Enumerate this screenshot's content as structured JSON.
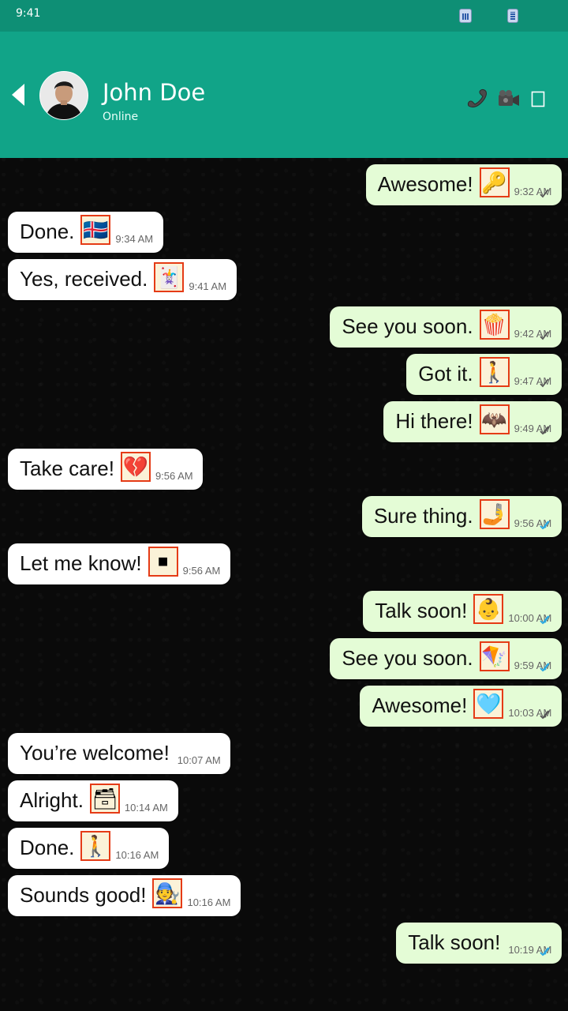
{
  "status_bar": {
    "time": "9:41"
  },
  "header": {
    "name": "John Doe",
    "status": "Online"
  },
  "colors": {
    "header": "#11a488",
    "status_bar": "#0e8f75",
    "incoming_bubble": "#ffffff",
    "outgoing_bubble": "#e4fcd6",
    "read_tick": "#2aa7e0",
    "sent_tick": "#555555"
  },
  "messages": [
    {
      "dir": "out",
      "text": "Awesome!",
      "emoji": "key-emoji",
      "emoji_char": "🔑",
      "time": "9:32 AM",
      "status": "sent"
    },
    {
      "dir": "in",
      "text": "Done.",
      "emoji": "iceland-flag-emoji",
      "emoji_char": "🇮🇸",
      "time": "9:34 AM"
    },
    {
      "dir": "in",
      "text": "Yes, received.",
      "emoji": "playing-card-emoji",
      "emoji_char": "🃏",
      "time": "9:41 AM"
    },
    {
      "dir": "out",
      "text": "See you soon.",
      "emoji": "popcorn-emoji",
      "emoji_char": "🍿",
      "time": "9:42 AM",
      "status": "sent"
    },
    {
      "dir": "out",
      "text": "Got it.",
      "emoji": "walking-right-emoji",
      "emoji_char": "🚶",
      "time": "9:47 AM",
      "status": "sent"
    },
    {
      "dir": "out",
      "text": "Hi there!",
      "emoji": "bat-emoji",
      "emoji_char": "🦇",
      "time": "9:49 AM",
      "status": "delivered"
    },
    {
      "dir": "in",
      "text": "Take care!",
      "emoji": "broken-heart-emoji",
      "emoji_char": "💔",
      "time": "9:56 AM"
    },
    {
      "dir": "out",
      "text": "Sure thing.",
      "emoji": "hand-with-phone-emoji",
      "emoji_char": "🤳",
      "time": "9:56 AM",
      "status": "read"
    },
    {
      "dir": "in",
      "text": "Let me know!",
      "emoji": "stop-button-emoji",
      "emoji_char": "⏹",
      "time": "9:56 AM"
    },
    {
      "dir": "out",
      "text": "Talk soon!",
      "emoji": "baby-emoji",
      "emoji_char": "👶",
      "time": "10:00 AM",
      "status": "read"
    },
    {
      "dir": "out",
      "text": "See you soon.",
      "emoji": "kite-emoji",
      "emoji_char": "🪁",
      "time": "9:59 AM",
      "status": "read"
    },
    {
      "dir": "out",
      "text": "Awesome!",
      "emoji": "light-blue-heart-emoji",
      "emoji_char": "🩵",
      "time": "10:03 AM",
      "status": "delivered"
    },
    {
      "dir": "in",
      "text": "You’re welcome!",
      "emoji": "",
      "emoji_char": "",
      "time": "10:07 AM"
    },
    {
      "dir": "in",
      "text": "Alright.",
      "emoji": "card-file-box-emoji",
      "emoji_char": "🗃",
      "time": "10:14 AM"
    },
    {
      "dir": "in",
      "text": "Done.",
      "emoji": "walking-right-emoji",
      "emoji_char": "🚶",
      "time": "10:16 AM"
    },
    {
      "dir": "in",
      "text": "Sounds good!",
      "emoji": "mechanic-emoji",
      "emoji_char": "🧑‍🔧",
      "time": "10:16 AM"
    },
    {
      "dir": "out",
      "text": "Talk soon!",
      "emoji": "",
      "emoji_char": "",
      "time": "10:19 AM",
      "status": "read"
    }
  ]
}
